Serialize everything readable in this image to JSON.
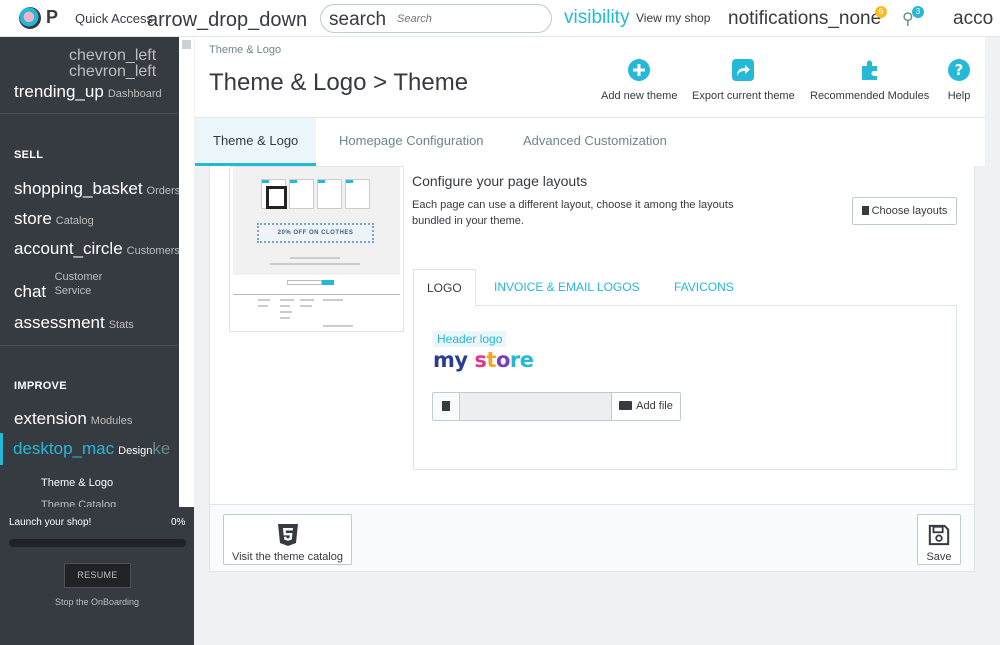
{
  "header": {
    "brand_letter": "P",
    "quick_access": "Quick Access",
    "quick_access_icon": "arrow_drop_down",
    "search_icon": "search",
    "search_placeholder": "Search",
    "visibility_icon": "visibility",
    "view_shop": "View my shop",
    "notifications_icon": "notifications_none",
    "notif_badge": "6",
    "trophy_badge": "3",
    "account_icon": "acco"
  },
  "sidebar": {
    "collapse_icon_1": "chevron_left",
    "collapse_icon_2": "chevron_left",
    "dashboard": {
      "icon": "trending_up",
      "label": "Dashboard"
    },
    "sell_title": "SELL",
    "sell_items": [
      {
        "icon": "shopping_basket",
        "label": "Orders"
      },
      {
        "icon": "store",
        "label": "Catalog"
      },
      {
        "icon": "account_circle",
        "label": "Customers"
      },
      {
        "icon": "chat",
        "label_line1": "Customer",
        "label_line2": "Service"
      },
      {
        "icon": "assessment",
        "label": "Stats"
      }
    ],
    "improve_title": "IMPROVE",
    "improve_items": [
      {
        "icon": "extension",
        "label": "Modules"
      },
      {
        "icon": "desktop_mac",
        "label": "Design",
        "tail": "ke"
      }
    ],
    "sub_items": [
      "Theme & Logo",
      "Theme Catalog"
    ]
  },
  "onboarding": {
    "title": "Launch your shop!",
    "percent": "0%",
    "progress": 0,
    "resume": "RESUME",
    "stop": "Stop the OnBoarding"
  },
  "page": {
    "breadcrumb": "Theme & Logo",
    "title": "Theme & Logo > Theme",
    "toolbar": {
      "add_theme": "Add new theme",
      "export_theme": "Export current theme",
      "recommended": "Recommended Modules",
      "help": "Help"
    },
    "tabs": [
      "Theme & Logo",
      "Homepage Configuration",
      "Advanced Customization"
    ]
  },
  "preview": {
    "banner_text": "20% OFF ON CLOTHES"
  },
  "layouts": {
    "title": "Configure your page layouts",
    "description": "Each page can use a different layout, choose it among the layouts bundled in your theme.",
    "button": "Choose layouts"
  },
  "logos": {
    "tabs": [
      "LOGO",
      "INVOICE & EMAIL LOGOS",
      "FAVICONS"
    ],
    "header_logo_label": "Header logo",
    "logo_text": {
      "part1": "my",
      "part2": "s",
      "part3": "t",
      "part4": "o",
      "part5": "re"
    },
    "file_value": "",
    "add_file": "Add file"
  },
  "footer": {
    "visit_catalog": "Visit the theme catalog",
    "save": "Save"
  },
  "colors": {
    "accent": "#25b9d7",
    "sidebar_bg": "#363a41"
  }
}
